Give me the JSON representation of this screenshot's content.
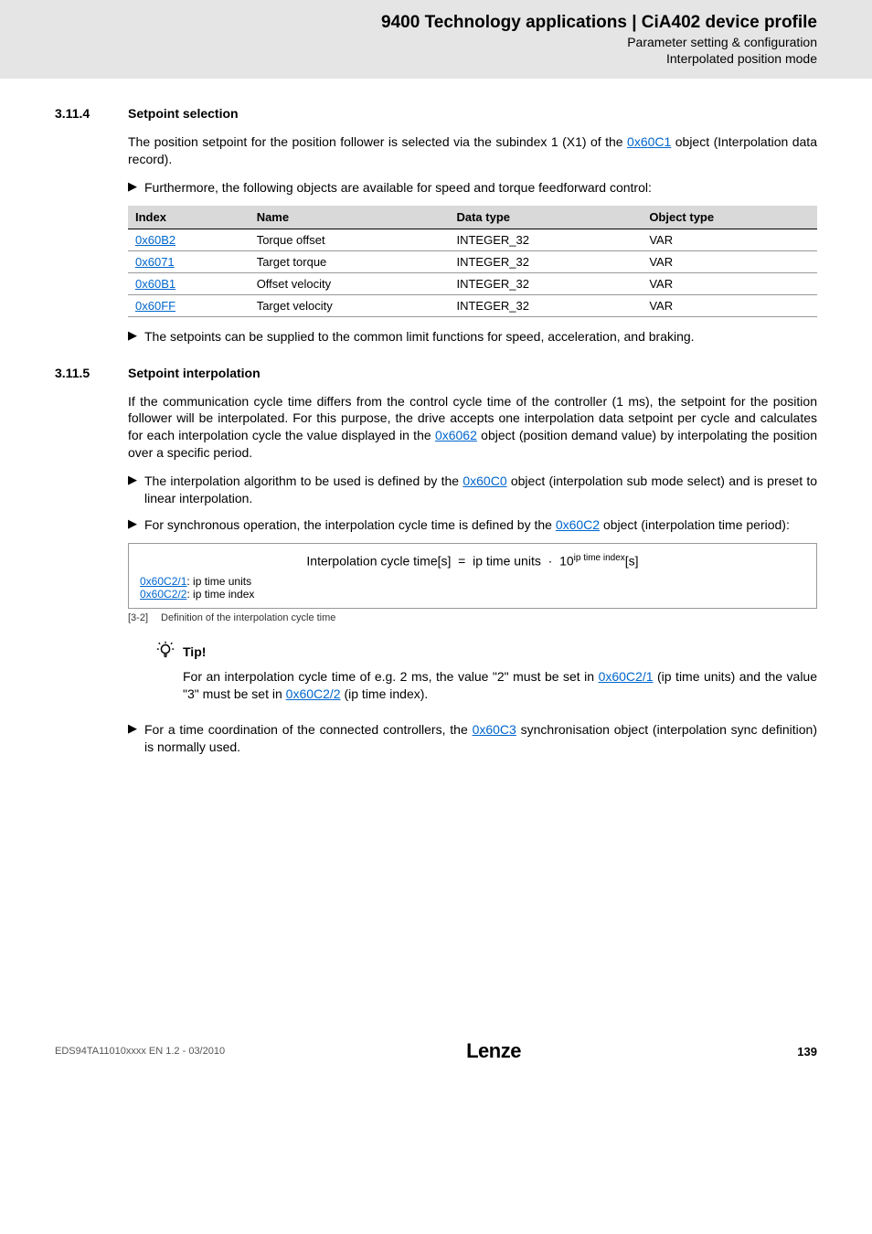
{
  "header": {
    "title": "9400 Technology applications | CiA402 device profile",
    "sub1": "Parameter setting & configuration",
    "sub2": "Interpolated position mode"
  },
  "sec1": {
    "num": "3.11.4",
    "title": "Setpoint selection",
    "p1a": "The position setpoint for the position follower is selected via the subindex 1 (X1) of the ",
    "p1_link": "0x60C1",
    "p1b": " object (Interpolation data record).",
    "b1": "Furthermore, the following objects are available for speed and torque feedforward control:",
    "b2": "The setpoints can be supplied to the common limit functions for speed, acceleration, and braking."
  },
  "table": {
    "h1": "Index",
    "h2": "Name",
    "h3": "Data type",
    "h4": "Object type",
    "rows": [
      {
        "idx": "0x60B2",
        "name": "Torque offset",
        "dt": "INTEGER_32",
        "ot": "VAR"
      },
      {
        "idx": "0x6071",
        "name": "Target torque",
        "dt": "INTEGER_32",
        "ot": "VAR"
      },
      {
        "idx": "0x60B1",
        "name": "Offset velocity",
        "dt": "INTEGER_32",
        "ot": "VAR"
      },
      {
        "idx": "0x60FF",
        "name": "Target velocity",
        "dt": "INTEGER_32",
        "ot": "VAR"
      }
    ]
  },
  "sec2": {
    "num": "3.11.5",
    "title": "Setpoint interpolation",
    "p1a": "If the communication cycle time differs from the control cycle time of the controller (1 ms), the setpoint for the position follower will be interpolated. For this purpose, the drive accepts one interpolation data setpoint per cycle and calculates for each interpolation cycle the value displayed in the ",
    "p1_link": "0x6062",
    "p1b": " object (position demand value) by interpolating the position over a specific period.",
    "b1a": "The interpolation algorithm to be used is defined by the ",
    "b1_link": "0x60C0",
    "b1b": " object (interpolation sub mode select) and is preset to linear interpolation.",
    "b2a": "For synchronous operation, the interpolation cycle time is defined by the ",
    "b2_link": "0x60C2",
    "b2b": " object (interpolation time period):",
    "b3a": "For a time coordination of the connected controllers, the ",
    "b3_link": "0x60C3",
    "b3b": " synchronisation object (interpolation sync definition) is normally used."
  },
  "formula": {
    "lhs": "Interpolation cycle time[s]",
    "eq": "=",
    "rhs1": "ip time units",
    "dot": "·",
    "base": "10",
    "exp": "ip time index",
    "unit": "[s]",
    "ref1_link": "0x60C2/1",
    "ref1_txt": ": ip time units",
    "ref2_link": "0x60C2/2",
    "ref2_txt": ": ip time index",
    "cap_num": "[3-2]",
    "cap_txt": "Definition of the interpolation cycle time"
  },
  "tip": {
    "label": "Tip!",
    "a": "For an interpolation cycle time of e.g. 2 ms, the value \"2\" must be set in ",
    "link1": "0x60C2/1",
    "b": " (ip time units) and the value \"3\" must be set in ",
    "link2": "0x60C2/2",
    "c": " (ip time index)."
  },
  "footer": {
    "left": "EDS94TA11010xxxx EN 1.2 - 03/2010",
    "logo": "Lenze",
    "page": "139"
  }
}
